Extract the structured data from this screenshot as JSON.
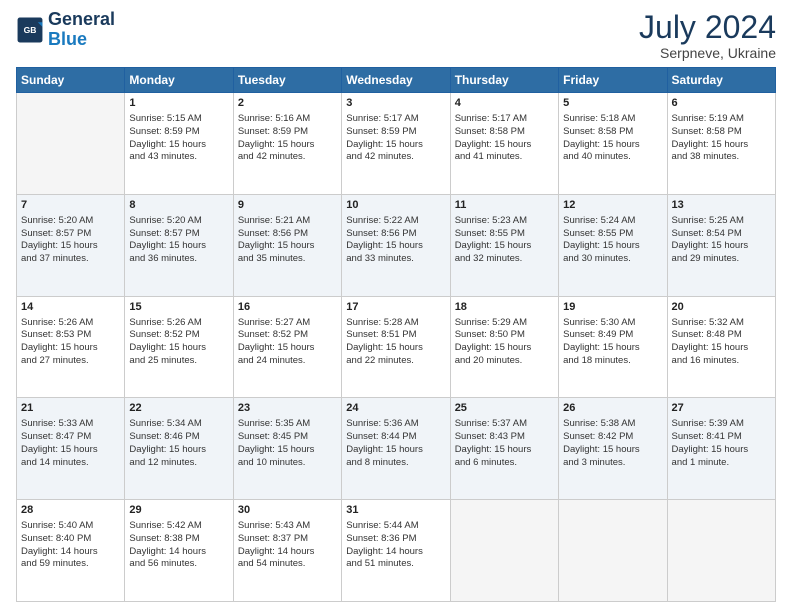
{
  "header": {
    "logo_line1": "General",
    "logo_line2": "Blue",
    "month_year": "July 2024",
    "location": "Serpneve, Ukraine"
  },
  "weekdays": [
    "Sunday",
    "Monday",
    "Tuesday",
    "Wednesday",
    "Thursday",
    "Friday",
    "Saturday"
  ],
  "weeks": [
    [
      {
        "day": "",
        "info": ""
      },
      {
        "day": "1",
        "info": "Sunrise: 5:15 AM\nSunset: 8:59 PM\nDaylight: 15 hours\nand 43 minutes."
      },
      {
        "day": "2",
        "info": "Sunrise: 5:16 AM\nSunset: 8:59 PM\nDaylight: 15 hours\nand 42 minutes."
      },
      {
        "day": "3",
        "info": "Sunrise: 5:17 AM\nSunset: 8:59 PM\nDaylight: 15 hours\nand 42 minutes."
      },
      {
        "day": "4",
        "info": "Sunrise: 5:17 AM\nSunset: 8:58 PM\nDaylight: 15 hours\nand 41 minutes."
      },
      {
        "day": "5",
        "info": "Sunrise: 5:18 AM\nSunset: 8:58 PM\nDaylight: 15 hours\nand 40 minutes."
      },
      {
        "day": "6",
        "info": "Sunrise: 5:19 AM\nSunset: 8:58 PM\nDaylight: 15 hours\nand 38 minutes."
      }
    ],
    [
      {
        "day": "7",
        "info": "Sunrise: 5:20 AM\nSunset: 8:57 PM\nDaylight: 15 hours\nand 37 minutes."
      },
      {
        "day": "8",
        "info": "Sunrise: 5:20 AM\nSunset: 8:57 PM\nDaylight: 15 hours\nand 36 minutes."
      },
      {
        "day": "9",
        "info": "Sunrise: 5:21 AM\nSunset: 8:56 PM\nDaylight: 15 hours\nand 35 minutes."
      },
      {
        "day": "10",
        "info": "Sunrise: 5:22 AM\nSunset: 8:56 PM\nDaylight: 15 hours\nand 33 minutes."
      },
      {
        "day": "11",
        "info": "Sunrise: 5:23 AM\nSunset: 8:55 PM\nDaylight: 15 hours\nand 32 minutes."
      },
      {
        "day": "12",
        "info": "Sunrise: 5:24 AM\nSunset: 8:55 PM\nDaylight: 15 hours\nand 30 minutes."
      },
      {
        "day": "13",
        "info": "Sunrise: 5:25 AM\nSunset: 8:54 PM\nDaylight: 15 hours\nand 29 minutes."
      }
    ],
    [
      {
        "day": "14",
        "info": "Sunrise: 5:26 AM\nSunset: 8:53 PM\nDaylight: 15 hours\nand 27 minutes."
      },
      {
        "day": "15",
        "info": "Sunrise: 5:26 AM\nSunset: 8:52 PM\nDaylight: 15 hours\nand 25 minutes."
      },
      {
        "day": "16",
        "info": "Sunrise: 5:27 AM\nSunset: 8:52 PM\nDaylight: 15 hours\nand 24 minutes."
      },
      {
        "day": "17",
        "info": "Sunrise: 5:28 AM\nSunset: 8:51 PM\nDaylight: 15 hours\nand 22 minutes."
      },
      {
        "day": "18",
        "info": "Sunrise: 5:29 AM\nSunset: 8:50 PM\nDaylight: 15 hours\nand 20 minutes."
      },
      {
        "day": "19",
        "info": "Sunrise: 5:30 AM\nSunset: 8:49 PM\nDaylight: 15 hours\nand 18 minutes."
      },
      {
        "day": "20",
        "info": "Sunrise: 5:32 AM\nSunset: 8:48 PM\nDaylight: 15 hours\nand 16 minutes."
      }
    ],
    [
      {
        "day": "21",
        "info": "Sunrise: 5:33 AM\nSunset: 8:47 PM\nDaylight: 15 hours\nand 14 minutes."
      },
      {
        "day": "22",
        "info": "Sunrise: 5:34 AM\nSunset: 8:46 PM\nDaylight: 15 hours\nand 12 minutes."
      },
      {
        "day": "23",
        "info": "Sunrise: 5:35 AM\nSunset: 8:45 PM\nDaylight: 15 hours\nand 10 minutes."
      },
      {
        "day": "24",
        "info": "Sunrise: 5:36 AM\nSunset: 8:44 PM\nDaylight: 15 hours\nand 8 minutes."
      },
      {
        "day": "25",
        "info": "Sunrise: 5:37 AM\nSunset: 8:43 PM\nDaylight: 15 hours\nand 6 minutes."
      },
      {
        "day": "26",
        "info": "Sunrise: 5:38 AM\nSunset: 8:42 PM\nDaylight: 15 hours\nand 3 minutes."
      },
      {
        "day": "27",
        "info": "Sunrise: 5:39 AM\nSunset: 8:41 PM\nDaylight: 15 hours\nand 1 minute."
      }
    ],
    [
      {
        "day": "28",
        "info": "Sunrise: 5:40 AM\nSunset: 8:40 PM\nDaylight: 14 hours\nand 59 minutes."
      },
      {
        "day": "29",
        "info": "Sunrise: 5:42 AM\nSunset: 8:38 PM\nDaylight: 14 hours\nand 56 minutes."
      },
      {
        "day": "30",
        "info": "Sunrise: 5:43 AM\nSunset: 8:37 PM\nDaylight: 14 hours\nand 54 minutes."
      },
      {
        "day": "31",
        "info": "Sunrise: 5:44 AM\nSunset: 8:36 PM\nDaylight: 14 hours\nand 51 minutes."
      },
      {
        "day": "",
        "info": ""
      },
      {
        "day": "",
        "info": ""
      },
      {
        "day": "",
        "info": ""
      }
    ]
  ]
}
